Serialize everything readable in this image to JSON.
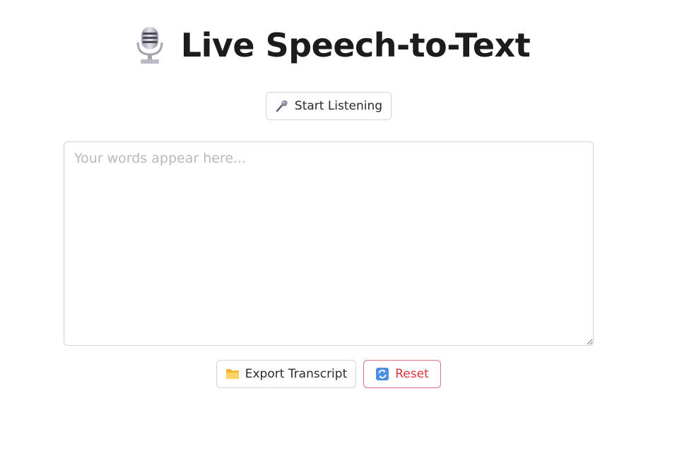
{
  "header": {
    "icon": "studio-microphone-icon",
    "title": "Live Speech-to-Text"
  },
  "controls": {
    "start_label": "Start Listening",
    "start_icon": "microphone-icon"
  },
  "transcript": {
    "value": "",
    "placeholder": "Your words appear here..."
  },
  "actions": {
    "export_label": "Export Transcript",
    "export_icon": "folder-icon",
    "reset_label": "Reset",
    "reset_icon": "refresh-icon"
  },
  "colors": {
    "reset_accent": "#d9363e",
    "reset_border": "#e0707a",
    "border": "#d4d4d4"
  }
}
